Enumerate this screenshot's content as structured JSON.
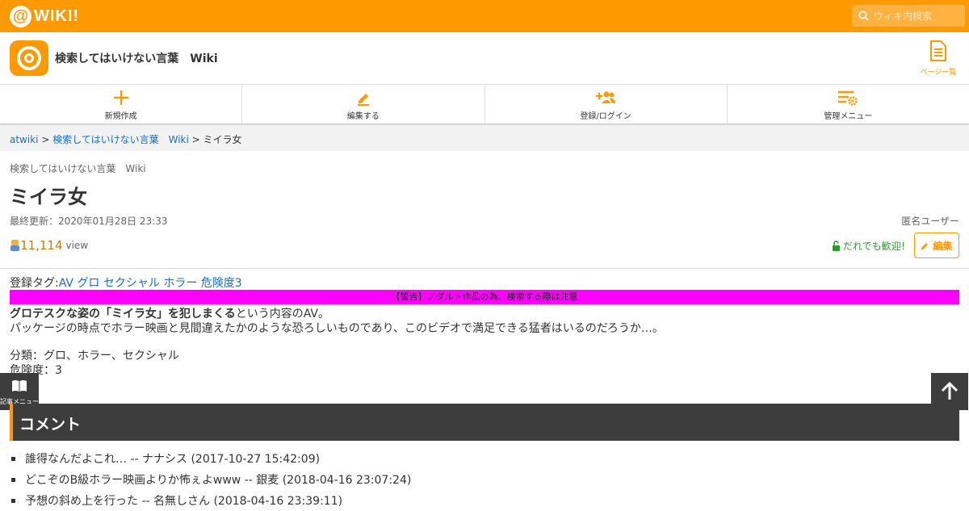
{
  "topbar": {
    "logo_text": "WIKI!",
    "logo_mark": "@",
    "search_placeholder": "ウィキ内検索"
  },
  "site": {
    "title": "検索してはいけない言葉　Wiki",
    "pagelist_label": "ページ一覧"
  },
  "toolbar": {
    "items": [
      {
        "label": "新規作成",
        "icon": "plus-icon"
      },
      {
        "label": "編集する",
        "icon": "pencil-icon"
      },
      {
        "label": "登録/ログイン",
        "icon": "add-user-icon"
      },
      {
        "label": "管理メニュー",
        "icon": "settings-list-icon"
      }
    ]
  },
  "breadcrumb": {
    "root": "atwiki",
    "sep": " > ",
    "wiki": "検索してはいけない言葉　Wiki",
    "current": "ミイラ女"
  },
  "page": {
    "wiki_name": "検索してはいけない言葉　Wiki",
    "title": "ミイラ女",
    "updated": "最終更新：2020年01月28日 23:33",
    "author": "匿名ユーザー",
    "views": "11,114",
    "views_unit": "view",
    "welcome": "だれでも歓迎！",
    "edit_label": "編集"
  },
  "content": {
    "tags_label": "登録タグ:",
    "tags": [
      "AV",
      "グロ",
      "セクシャル",
      "ホラー",
      "危険度3"
    ],
    "warning": "【警告】アダルト作品の為、検索する際は注意",
    "intro_bold": "グロテスクな姿の「ミイラ女」を犯しまくる",
    "intro_rest": "という内容のAV。",
    "line2": "パッケージの時点でホラー映画と見間違えたかのような恐ろしいものであり、このビデオで満足できる猛者はいるのだろうか…。",
    "classification": "分類：グロ、ホラー、セクシャル",
    "danger": "危険度：3"
  },
  "side_menu_label": "記事メニュー",
  "comments": {
    "heading": "コメント",
    "items": [
      "誰得なんだよこれ… -- ナナシス (2017-10-27 15:42:09)",
      "どこぞのB級ホラー映画よりか怖ぇよwww -- 銀麦 (2018-04-16 23:07:24)",
      "予想の斜め上を行った -- 名無しさん (2018-04-16 23:39:11)"
    ]
  },
  "colors": {
    "brand": "#ff9900",
    "link": "#1a6ec4",
    "warning_bg": "#ff00ff",
    "dark": "#3d3d3d"
  }
}
